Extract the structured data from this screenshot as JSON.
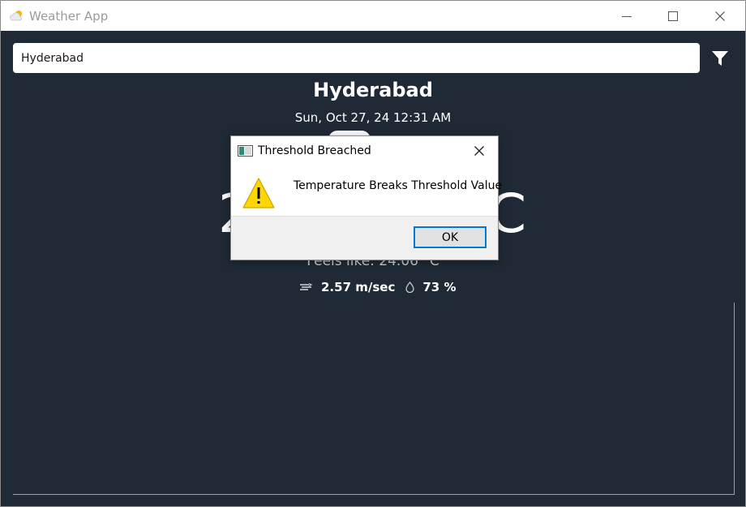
{
  "window": {
    "title": "Weather App",
    "icons": {
      "app": "cloud-sun-icon",
      "minimize": "minimize-icon",
      "maximize": "maximize-icon",
      "close": "close-icon"
    }
  },
  "search": {
    "value": "Hyderabad",
    "placeholder": ""
  },
  "toolbar": {
    "filter_icon": "filter-icon"
  },
  "weather": {
    "city": "Hyderabad",
    "datetime": "Sun, Oct 27, 24 12:31 AM",
    "temperature_left": "2",
    "temperature_right": "C",
    "feels_like": "Feels like: 24.06 °C",
    "wind": "2.57 m/sec",
    "humidity": "73 %",
    "icons": {
      "wind": "wind-icon",
      "humidity": "droplet-icon"
    }
  },
  "dialog": {
    "title": "Threshold Breached",
    "message": "Temperature Breaks Threshold Value",
    "ok_label": "OK",
    "icons": {
      "title": "window-icon",
      "warning": "warning-icon",
      "close": "close-icon"
    }
  },
  "colors": {
    "background": "#1f2a36",
    "accent": "#0078d7",
    "warning": "#ffd700"
  }
}
